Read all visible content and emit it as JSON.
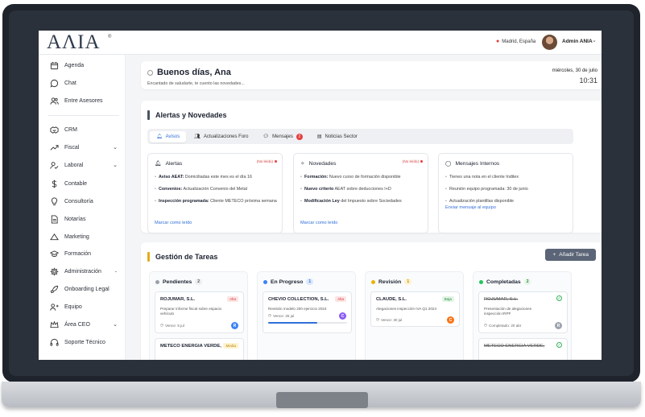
{
  "colors": {
    "accent": "#2f6fd8",
    "alert": "#e53e3e",
    "gold": "#e5ac1a",
    "green": "#34b25a"
  },
  "app": {
    "logo": "AɅIA",
    "logo_mark": "®"
  },
  "topbar": {
    "location": "Madrid, España",
    "user": "Admin ANIA"
  },
  "sidebar": {
    "items": [
      {
        "label": "Agenda",
        "icon": "calendar-icon"
      },
      {
        "label": "Chat",
        "icon": "chat-icon"
      },
      {
        "label": "Entre Asesores",
        "icon": "users-icon"
      },
      {
        "label": "CRM",
        "icon": "handshake-icon"
      },
      {
        "label": "Fiscal",
        "icon": "trend-icon"
      },
      {
        "label": "Laboral",
        "icon": "user-check-icon"
      },
      {
        "label": "Contable",
        "icon": "dollar-icon"
      },
      {
        "label": "Consultoría",
        "icon": "bulb-icon"
      },
      {
        "label": "Notarías",
        "icon": "document-icon"
      },
      {
        "label": "Marketing",
        "icon": "megaphone-icon"
      },
      {
        "label": "Formación",
        "icon": "graduation-icon"
      },
      {
        "label": "Administración",
        "icon": "gear-icon"
      },
      {
        "label": "Onboarding Legal",
        "icon": "rocket-icon"
      },
      {
        "label": "Equipo",
        "icon": "team-icon"
      },
      {
        "label": "Área CEO",
        "icon": "crown-icon"
      },
      {
        "label": "Soporte Técnico",
        "icon": "headset-icon"
      }
    ]
  },
  "welcome": {
    "greeting": "Buenos días, Ana",
    "subtitle": "Encantado de saludarte, te cuento las novedades...",
    "date": "miércoles, 30 de julio",
    "time": "10:31"
  },
  "alerts": {
    "title": "Alertas y Novedades",
    "tabs": [
      {
        "label": "Avisos"
      },
      {
        "label": "Actualizaciones Foro"
      },
      {
        "label": "Mensajes",
        "badge": "2"
      },
      {
        "label": "Noticias Sector"
      }
    ],
    "cards": [
      {
        "title": "Alertas",
        "unread": "(No leído)",
        "items": [
          {
            "b": "Aviso AEAT:",
            "t": " Domiciliadas este mes es el día 16"
          },
          {
            "b": "Convenios:",
            "t": " Actualización Convenio del Metal"
          },
          {
            "b": "Inspección programada:",
            "t": " Cliente METECO próxima semana"
          }
        ],
        "link": "Marcar como leído"
      },
      {
        "title": "Novedades",
        "unread": "(No leído)",
        "items": [
          {
            "b": "Formación:",
            "t": " Nuevo curso de formación disponible"
          },
          {
            "b": "Nuevo criterio",
            "t": " AEAT sobre deducciones I+D"
          },
          {
            "b": "Modificación Ley",
            "t": " del Impuesto sobre Sociedades"
          }
        ],
        "link": "Marcar como leído"
      },
      {
        "title": "Mensajes Internos",
        "unread": "",
        "items": [
          {
            "b": "",
            "t": "Tienes una nota en el cliente Inditex"
          },
          {
            "b": "",
            "t": "Reunión equipo programada: 30 de junio"
          },
          {
            "b": "",
            "t": "Actualización plantillas disponible"
          }
        ],
        "link": "Enviar mensaje al equipo"
      }
    ]
  },
  "tasks": {
    "title": "Gestión de Tareas",
    "add_label": "Añadir Tarea",
    "columns": [
      {
        "name": "Pendientes",
        "count": "2",
        "color": "#9aa1ab",
        "cards": [
          {
            "title": "ROJUMAR, S.L.",
            "desc": "Preparar informe fiscal sobre espacio vehículo",
            "due": "Vence: 5 jul",
            "priority": "Alta",
            "assignee": "R"
          },
          {
            "title": "METECO ENERGIA VERDE,",
            "priority": "Media"
          }
        ]
      },
      {
        "name": "En Progreso",
        "count": "1",
        "color": "#3b82f6",
        "cards": [
          {
            "title": "CHEVIO COLLECTION, S.L.",
            "desc": "Revisión modelo 200 ejercicio 2024",
            "due": "Vence: 25 jul",
            "priority": "Alta",
            "assignee": "C",
            "progress": 0.62
          }
        ]
      },
      {
        "name": "Revisión",
        "count": "1",
        "color": "#eab308",
        "cards": [
          {
            "title": "CLAUDE, S.L.",
            "desc": "Alegaciones inspección IVA Q1 2024",
            "due": "Vence: 30 jul",
            "priority": "Baja",
            "assignee": "C"
          }
        ]
      },
      {
        "name": "Completadas",
        "count": "2",
        "color": "#22c55e",
        "cards": [
          {
            "title": "ROJUMAR, S.L.",
            "desc": "Presentación de alegaciones inspección IRPF",
            "due": "Completado: 20 abr",
            "assignee": "R"
          },
          {
            "title": "METECO ENERGIA VERDE,"
          }
        ]
      }
    ]
  }
}
